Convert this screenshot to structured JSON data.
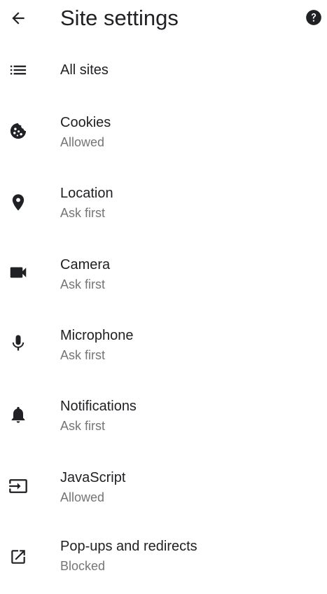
{
  "header": {
    "title": "Site settings",
    "back_icon": "arrow-back-icon",
    "help_icon": "help-icon"
  },
  "items": [
    {
      "label": "All sites",
      "sub": "",
      "icon": "list-icon"
    },
    {
      "label": "Cookies",
      "sub": "Allowed",
      "icon": "cookie-icon"
    },
    {
      "label": "Location",
      "sub": "Ask first",
      "icon": "location-pin-icon"
    },
    {
      "label": "Camera",
      "sub": "Ask first",
      "icon": "videocam-icon"
    },
    {
      "label": "Microphone",
      "sub": "Ask first",
      "icon": "mic-icon"
    },
    {
      "label": "Notifications",
      "sub": "Ask first",
      "icon": "bell-icon"
    },
    {
      "label": "JavaScript",
      "sub": "Allowed",
      "icon": "input-icon"
    },
    {
      "label": "Pop-ups and redirects",
      "sub": "Blocked",
      "icon": "open-in-new-icon"
    }
  ],
  "colors": {
    "text_primary": "#202124",
    "text_secondary": "#757575",
    "icon": "#202124"
  }
}
